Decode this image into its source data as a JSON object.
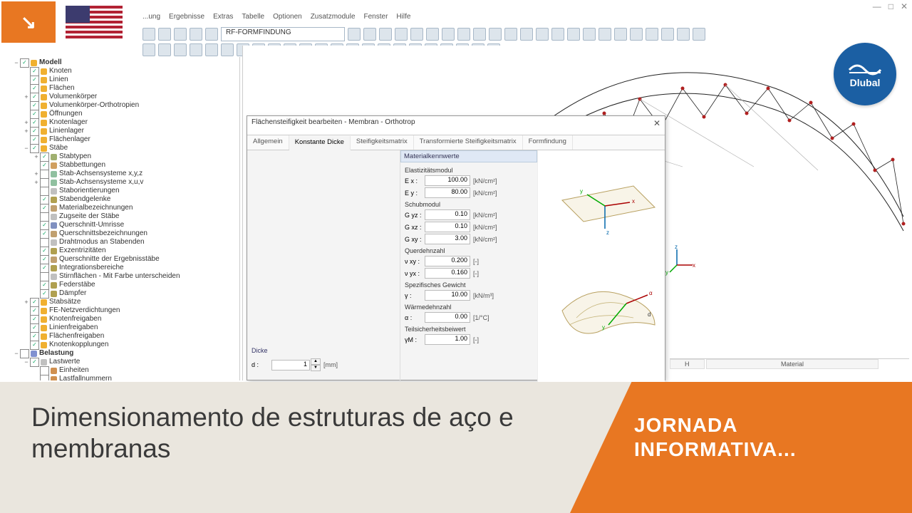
{
  "window": {
    "title": "",
    "min": "—",
    "max": "□",
    "close": "✕"
  },
  "brand": {
    "name": "Dlubal"
  },
  "menu": [
    "...ung",
    "Ergebnisse",
    "Extras",
    "Tabelle",
    "Optionen",
    "Zusatzmodule",
    "Fenster",
    "Hilfe"
  ],
  "address": "RF-FORMFINDUNG",
  "tree": [
    {
      "d": 0,
      "tw": "−",
      "chk": true,
      "c": "#f0b030",
      "t": "Modell",
      "bold": true
    },
    {
      "d": 1,
      "tw": "",
      "chk": true,
      "c": "#f0b030",
      "t": "Knoten"
    },
    {
      "d": 1,
      "tw": "",
      "chk": true,
      "c": "#f0b030",
      "t": "Linien"
    },
    {
      "d": 1,
      "tw": "",
      "chk": true,
      "c": "#f0b030",
      "t": "Flächen"
    },
    {
      "d": 1,
      "tw": "+",
      "chk": true,
      "c": "#f0b030",
      "t": "Volumenkörper"
    },
    {
      "d": 1,
      "tw": "",
      "chk": true,
      "c": "#f0b030",
      "t": "Volumenkörper-Orthotropien"
    },
    {
      "d": 1,
      "tw": "",
      "chk": true,
      "c": "#f0b030",
      "t": "Öffnungen"
    },
    {
      "d": 1,
      "tw": "+",
      "chk": true,
      "c": "#f0b030",
      "t": "Knotenlager"
    },
    {
      "d": 1,
      "tw": "+",
      "chk": true,
      "c": "#f0b030",
      "t": "Linienlager"
    },
    {
      "d": 1,
      "tw": "",
      "chk": true,
      "c": "#f0b030",
      "t": "Flächenlager"
    },
    {
      "d": 1,
      "tw": "−",
      "chk": true,
      "c": "#f0b030",
      "t": "Stäbe"
    },
    {
      "d": 2,
      "tw": "+",
      "chk": true,
      "c": "#a0b070",
      "t": "Stabtypen"
    },
    {
      "d": 2,
      "tw": "",
      "chk": true,
      "c": "#d0a060",
      "t": "Stabbettungen"
    },
    {
      "d": 2,
      "tw": "+",
      "chk": false,
      "c": "#90c0a0",
      "t": "Stab-Achsensysteme x,y,z"
    },
    {
      "d": 2,
      "tw": "+",
      "chk": false,
      "c": "#90c0a0",
      "t": "Stab-Achsensysteme x,u,v"
    },
    {
      "d": 2,
      "tw": "",
      "chk": false,
      "c": "#c0c0c0",
      "t": "Staborientierungen"
    },
    {
      "d": 2,
      "tw": "",
      "chk": true,
      "c": "#b0a050",
      "t": "Stabendgelenke"
    },
    {
      "d": 2,
      "tw": "",
      "chk": true,
      "c": "#c0a070",
      "t": "Materialbezeichnungen"
    },
    {
      "d": 2,
      "tw": "",
      "chk": false,
      "c": "#c0c0c0",
      "t": "Zugseite der Stäbe"
    },
    {
      "d": 2,
      "tw": "",
      "chk": true,
      "c": "#8090c0",
      "t": "Querschnitt-Umrisse"
    },
    {
      "d": 2,
      "tw": "",
      "chk": true,
      "c": "#c0a070",
      "t": "Querschnittsbezeichnungen"
    },
    {
      "d": 2,
      "tw": "",
      "chk": false,
      "c": "#c0c0c0",
      "t": "Drahtmodus an Stabenden"
    },
    {
      "d": 2,
      "tw": "",
      "chk": true,
      "c": "#b0a050",
      "t": "Exzentrizitäten"
    },
    {
      "d": 2,
      "tw": "",
      "chk": true,
      "c": "#c0a070",
      "t": "Querschnitte der Ergebnisstäbe"
    },
    {
      "d": 2,
      "tw": "",
      "chk": true,
      "c": "#b0a050",
      "t": "Integrationsbereiche"
    },
    {
      "d": 2,
      "tw": "",
      "chk": false,
      "c": "#c0c0c0",
      "t": "Stirnflächen - Mit Farbe unterscheiden"
    },
    {
      "d": 2,
      "tw": "",
      "chk": true,
      "c": "#b0a050",
      "t": "Federstäbe"
    },
    {
      "d": 2,
      "tw": "",
      "chk": true,
      "c": "#b0a050",
      "t": "Dämpfer"
    },
    {
      "d": 1,
      "tw": "+",
      "chk": true,
      "c": "#f0b030",
      "t": "Stabsätze"
    },
    {
      "d": 1,
      "tw": "",
      "chk": true,
      "c": "#f0b030",
      "t": "FE-Netzverdichtungen"
    },
    {
      "d": 1,
      "tw": "",
      "chk": true,
      "c": "#f0b030",
      "t": "Knotenfreigaben"
    },
    {
      "d": 1,
      "tw": "",
      "chk": true,
      "c": "#f0b030",
      "t": "Linienfreigaben"
    },
    {
      "d": 1,
      "tw": "",
      "chk": true,
      "c": "#f0b030",
      "t": "Flächenfreigaben"
    },
    {
      "d": 1,
      "tw": "",
      "chk": true,
      "c": "#f0b030",
      "t": "Knotenkopplungen"
    },
    {
      "d": 0,
      "tw": "−",
      "chk": false,
      "c": "#8090d0",
      "t": "Belastung",
      "bold": true
    },
    {
      "d": 1,
      "tw": "−",
      "chk": true,
      "c": "#c0c0c0",
      "t": "Lastwerte"
    },
    {
      "d": 2,
      "tw": "",
      "chk": false,
      "c": "#d09050",
      "t": "Einheiten"
    },
    {
      "d": 2,
      "tw": "",
      "chk": false,
      "c": "#d09050",
      "t": "Lastfallnummern"
    }
  ],
  "dialog": {
    "title": "Flächensteifigkeit bearbeiten - Membran - Orthotrop",
    "close": "✕",
    "tabs": [
      "Allgemein",
      "Konstante Dicke",
      "Steifigkeitsmatrix",
      "Transformierte Steifigkeitsmatrix",
      "Formfindung"
    ],
    "activeTab": 1,
    "dickeHeader": "Dicke",
    "d_lbl": "d :",
    "d_val": "1",
    "d_unit": "[mm]",
    "matHeader": "Materialkennwerte",
    "g_elast": "Elastizitätsmodul",
    "ex_l": "E x :",
    "ex_v": "100.00",
    "ex_u": "[kN/cm²]",
    "ey_l": "E y :",
    "ey_v": "80.00",
    "ey_u": "[kN/cm²]",
    "g_schub": "Schubmodul",
    "gyz_l": "G yz :",
    "gyz_v": "0.10",
    "gyz_u": "[kN/cm²]",
    "gxz_l": "G xz :",
    "gxz_v": "0.10",
    "gxz_u": "[kN/cm²]",
    "gxy_l": "G xy :",
    "gxy_v": "3.00",
    "gxy_u": "[kN/cm²]",
    "g_quer": "Querdehnzahl",
    "vxy_l": "ν xy :",
    "vxy_v": "0.200",
    "vxy_u": "[-]",
    "vyx_l": "ν yx :",
    "vyx_v": "0.160",
    "vyx_u": "[-]",
    "g_spez": "Spezifisches Gewicht",
    "gam_l": "γ :",
    "gam_v": "10.00",
    "gam_u": "[kN/m³]",
    "g_warm": "Wärmedehnzahl",
    "alp_l": "α :",
    "alp_v": "0.00",
    "alp_u": "[1/°C]",
    "g_teil": "Teilsicherheitsbeiwert",
    "ym_l": "γM :",
    "ym_v": "1.00",
    "ym_u": "[-]"
  },
  "table": {
    "colH": "H",
    "colMat": "Material"
  },
  "overlay": {
    "title": "Dimensionamento de estruturas de aço e membranas",
    "subtitle": "JORNADA INFORMATIVA..."
  },
  "axis": {
    "x": "x",
    "y": "y",
    "z": "z"
  }
}
